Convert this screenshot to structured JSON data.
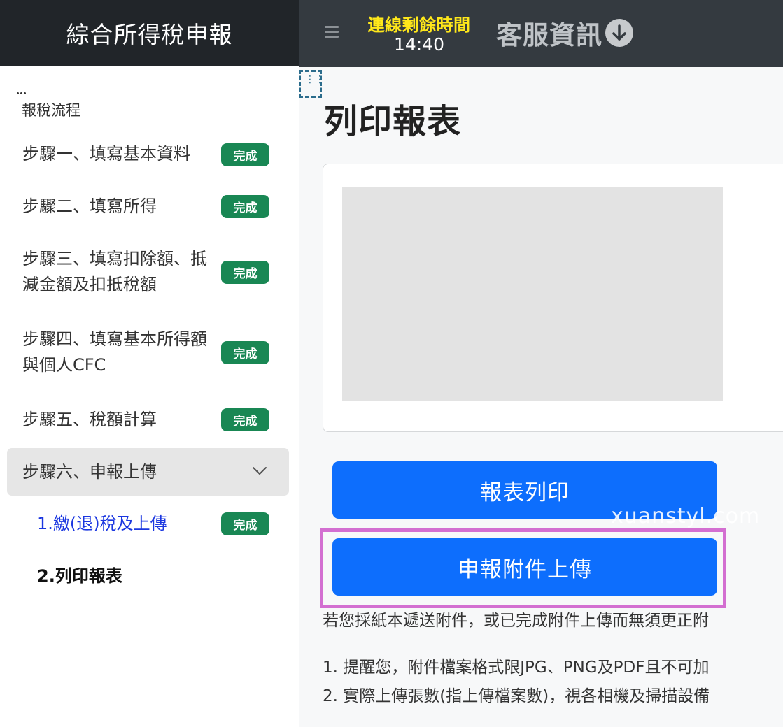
{
  "header": {
    "app_title": "綜合所得稅申報",
    "timer_label": "連線剩餘時間",
    "timer_value": "14:40",
    "service_info": "客服資訊"
  },
  "sidebar": {
    "section_title": "報稅流程",
    "steps": [
      {
        "label": "步驟一、填寫基本資料",
        "badge": "完成"
      },
      {
        "label": "步驟二、填寫所得",
        "badge": "完成"
      },
      {
        "label_line1": "步驟三、填寫扣除額、抵",
        "label_line2": "減金額及扣抵稅額",
        "badge": "完成"
      },
      {
        "label_line1": "步驟四、填寫基本所得額",
        "label_line2": "與個人CFC",
        "badge": "完成"
      },
      {
        "label": "步驟五、稅額計算",
        "badge": "完成"
      },
      {
        "label": "步驟六、申報上傳"
      }
    ],
    "sub_steps": [
      {
        "label": "1.繳(退)稅及上傳",
        "badge": "完成"
      },
      {
        "label": "2.列印報表"
      }
    ]
  },
  "main": {
    "page_title": "列印報表",
    "print_button": "報表列印",
    "upload_button": "申報附件上傳",
    "watermark": "xuanstyl.com",
    "note_1": "若您採紙本遞送附件，或已完成附件上傳而無須更正附",
    "note_2": "1. 提醒您，附件檔案格式限JPG、PNG及PDF且不可加",
    "note_3": "2. 實際上傳張數(指上傳檔案數)，視各相機及掃描設備"
  },
  "colors": {
    "primary": "#0d6efd",
    "success": "#198754",
    "highlight": "#d36fd1",
    "timer": "#ffe81a"
  }
}
